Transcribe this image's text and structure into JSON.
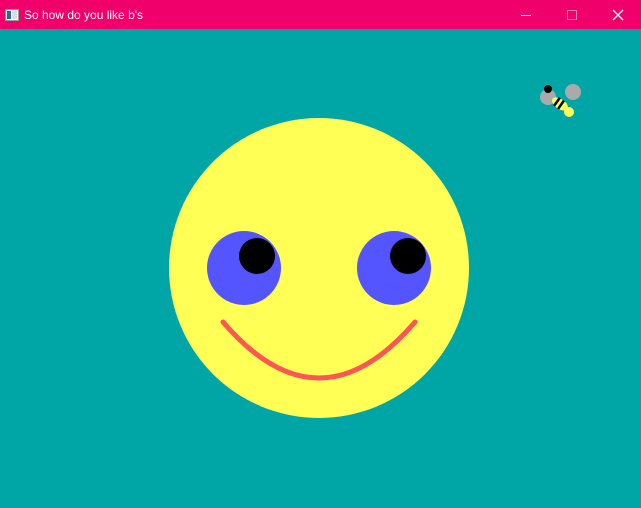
{
  "window": {
    "title": "So how do you like b's",
    "titlebar_color": "#f0006a",
    "text_color": "#ffffff"
  },
  "controls": {
    "minimize_icon": "minimize-icon",
    "maximize_icon": "maximize-icon",
    "close_icon": "close-icon"
  },
  "scene": {
    "background_color": "#00a6a6",
    "face_color": "#ffff55",
    "iris_color": "#5555ff",
    "pupil_color": "#000000",
    "mouth_color": "#ff5555",
    "bee": {
      "body_color": "#ffff55",
      "stripe_color": "#000000",
      "wing_color": "#aaaaaa"
    }
  }
}
